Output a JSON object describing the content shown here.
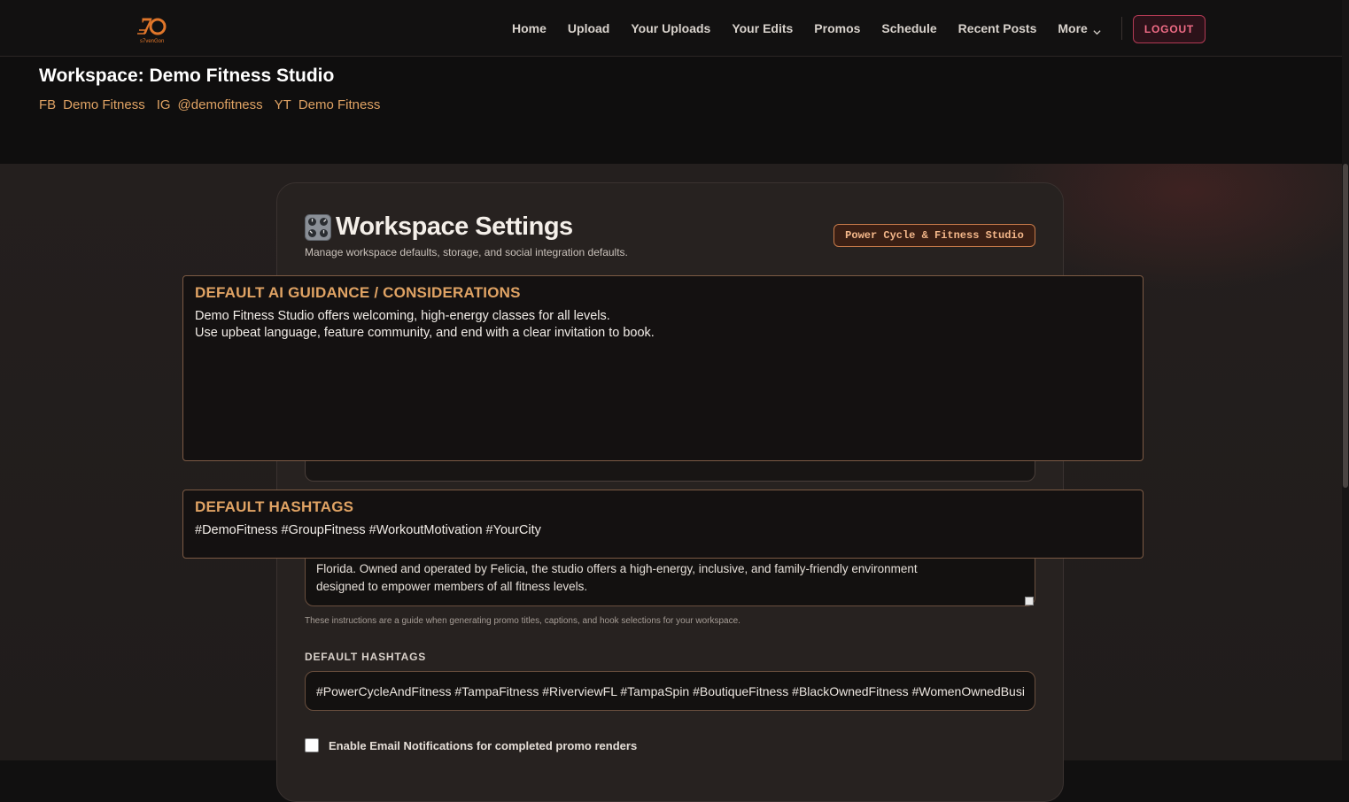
{
  "nav": {
    "logo_alt": "s7venGon",
    "links": [
      "Home",
      "Upload",
      "Your Uploads",
      "Your Edits",
      "Promos",
      "Schedule",
      "Recent Posts"
    ],
    "more_label": "More",
    "logout_label": "LOGOUT"
  },
  "workspace": {
    "title": "Workspace: Demo Fitness Studio",
    "socials": [
      {
        "tag": "FB",
        "handle": "Demo Fitness"
      },
      {
        "tag": "IG",
        "handle": "@demofitness"
      },
      {
        "tag": "YT",
        "handle": "Demo Fitness"
      }
    ]
  },
  "settings": {
    "title": "Workspace Settings",
    "subtitle": "Manage workspace defaults, storage, and social integration defaults.",
    "studio_badge": "Power Cycle & Fitness Studio",
    "guidance_visible_text_line1": "Florida. Owned and operated by Felicia, the studio offers a high-energy, inclusive, and family-friendly environment",
    "guidance_visible_text_line2": "designed to empower members of all fitness levels.",
    "helper_text": "These instructions are a guide when generating promo titles, captions, and hook selections for your workspace.",
    "hashtags_label": "DEFAULT HASHTAGS",
    "hashtags_value": "#PowerCycleAndFitness #TampaFitness #RiverviewFL #TampaSpin #BoutiqueFitness #BlackOwnedFitness #WomenOwnedBusiness",
    "email_notifications_label": "Enable Email Notifications for completed promo renders",
    "email_notifications_checked": false
  },
  "overlay_ai": {
    "heading": "DEFAULT AI GUIDANCE / CONSIDERATIONS",
    "line1": "Demo Fitness Studio offers welcoming, high-energy classes for all levels.",
    "line2": "Use upbeat language, feature community, and end with a clear invitation to book."
  },
  "overlay_hashtags": {
    "heading": "DEFAULT HASHTAGS",
    "value": "#DemoFitness #GroupFitness #WorkoutMotivation #YourCity"
  },
  "colors": {
    "accent": "#e0a364",
    "logout": "#f06c86",
    "background": "#111010"
  }
}
